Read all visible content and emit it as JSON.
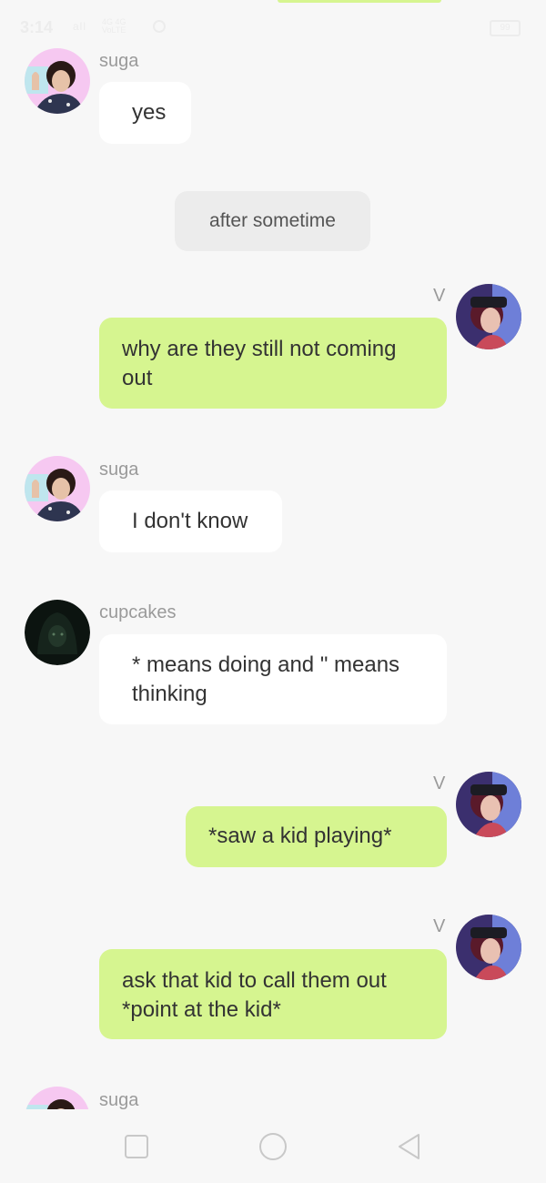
{
  "status_bar": {
    "time": "3:14",
    "signal": "all",
    "network_line1": "4G 4G",
    "network_line2": "VoLTE",
    "battery": "99",
    "icons": [
      "signal-icon",
      "network-icon",
      "sync-icon",
      "battery-icon"
    ]
  },
  "colors": {
    "background": "#f7f7f7",
    "incoming_bubble": "#ffffff",
    "outgoing_bubble": "#d6f590",
    "system_note": "#ececec",
    "name_text": "#9a9a9a"
  },
  "messages": [
    {
      "sender": "suga",
      "text": "yes",
      "direction": "incoming"
    },
    {
      "type": "system",
      "text": "after sometime"
    },
    {
      "sender": "V",
      "text": "why are they still not coming out",
      "direction": "outgoing"
    },
    {
      "sender": "suga",
      "text": "I don't know",
      "direction": "incoming"
    },
    {
      "sender": "cupcakes",
      "text": "* means doing and \" means thinking",
      "direction": "incoming"
    },
    {
      "sender": "V",
      "text": "*saw a kid playing*",
      "direction": "outgoing"
    },
    {
      "sender": "V",
      "text": "ask that kid to call them out *point at the kid*",
      "direction": "outgoing"
    },
    {
      "sender": "suga",
      "text": "",
      "direction": "incoming"
    }
  ],
  "nav_bar": {
    "buttons": [
      "recent-apps-icon",
      "home-icon",
      "back-icon"
    ]
  }
}
